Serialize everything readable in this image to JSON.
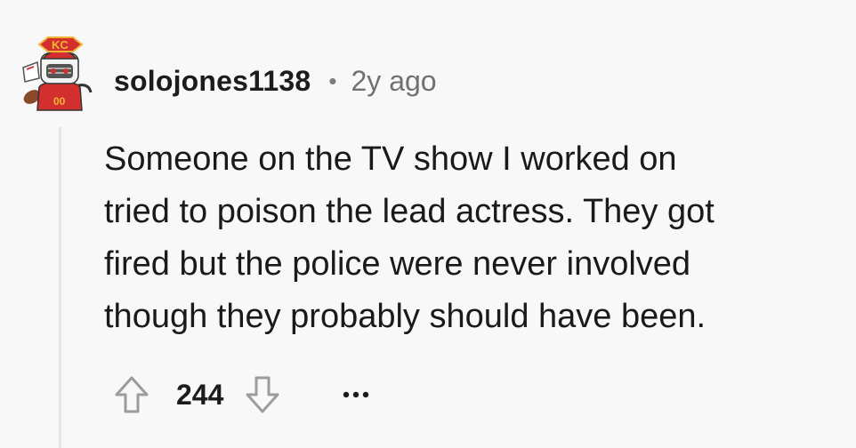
{
  "comment": {
    "username": "solojones1138",
    "separator": "•",
    "timestamp": "2y ago",
    "body_lines": [
      "Someone on the TV show I worked on",
      "tried to poison the lead actress. They got",
      "fired but the police were never involved",
      "though they probably should have been."
    ],
    "score": "244",
    "avatar": {
      "icon": "avatar-chiefs-robot-icon",
      "logo_text": "KC",
      "jersey_number": "00",
      "brand_red": "#d32f2f",
      "brand_gold": "#f2b632"
    }
  },
  "icons": {
    "upvote": "upvote-arrow-icon",
    "downvote": "downvote-arrow-icon",
    "more": "more-options-icon"
  },
  "colors": {
    "background": "#f8f8f9",
    "text": "#1c1c1c",
    "meta": "#6e7275",
    "thread_line": "#e4e6e8",
    "icon_stroke": "#9a9c9e"
  }
}
